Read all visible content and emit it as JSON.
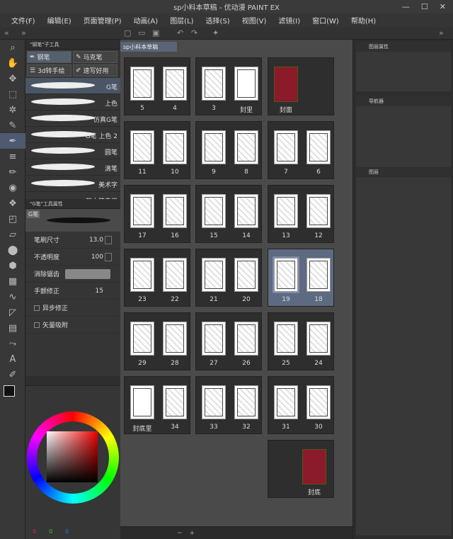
{
  "title": "sp小料本草稿 - 优动漫 PAINT EX",
  "menu": [
    "文件(F)",
    "编辑(E)",
    "页面管理(P)",
    "动画(A)",
    "图层(L)",
    "选择(S)",
    "视图(V)",
    "滤镜(I)",
    "窗口(W)",
    "帮助(H)"
  ],
  "subtool": {
    "title": "\"钢笔\"子工具",
    "tabs": [
      "钢笔",
      "马克笔",
      "3d转手绘",
      "速写好用"
    ],
    "brushes": [
      "G笔",
      "上色",
      "仿真G笔",
      "G笔 上色 2",
      "圆笔",
      "滴笔",
      "美术字",
      "蘸水笔专用"
    ]
  },
  "toolprop": {
    "title": "\"G笔\"工具属性",
    "preview_label": "G笔",
    "rows": [
      {
        "label": "笔刷尺寸",
        "value": "13.0"
      },
      {
        "label": "不透明度",
        "value": "100"
      },
      {
        "label": "消除锯齿",
        "value": ""
      },
      {
        "label": "手颤修正",
        "value": "15"
      },
      {
        "label": "异步修正",
        "value": ""
      },
      {
        "label": "矢量吸附",
        "value": ""
      }
    ]
  },
  "document": {
    "tab": "sp小料本草稿"
  },
  "pages": [
    [
      "5",
      "4"
    ],
    [
      "3",
      "封里"
    ],
    [
      "封面"
    ],
    [
      "11",
      "10"
    ],
    [
      "9",
      "8"
    ],
    [
      "7",
      "6"
    ],
    [
      "17",
      "16"
    ],
    [
      "15",
      "14"
    ],
    [
      "13",
      "12"
    ],
    [
      "23",
      "22"
    ],
    [
      "21",
      "20"
    ],
    [
      "19",
      "18"
    ],
    [
      "29",
      "28"
    ],
    [
      "27",
      "26"
    ],
    [
      "25",
      "24"
    ],
    [
      "封底里",
      "34"
    ],
    [
      "33",
      "32"
    ],
    [
      "31",
      "30"
    ],
    [
      "封底"
    ]
  ],
  "selected_page": "19",
  "right": {
    "layer_prop": "图层属性",
    "navigator": "导航器",
    "layers": "图层"
  },
  "color": {
    "values": [
      "0",
      "0",
      "0"
    ],
    "accent": "#7d8aa8",
    "cover": "#8b1a2a"
  }
}
